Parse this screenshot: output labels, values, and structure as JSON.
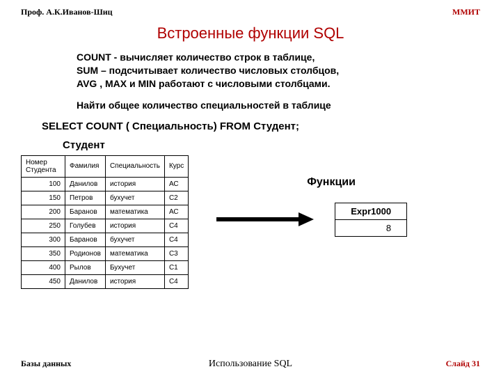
{
  "header": {
    "left": "Проф. А.К.Иванов-Шиц",
    "right": "ММИТ"
  },
  "title": "Встроенные функции SQL",
  "body": {
    "p1_l1": "COUNT - вычисляет количество строк в таблице,",
    "p1_l2": "SUM – подсчитывает количество числовых столбцов,",
    "p1_l3": "AVG , MAX и MIN работают с числовыми столбцами.",
    "p2": "Найти общее количество специальностей в таблице"
  },
  "sql": "SELECT COUNT ( Специальность) FROM Студент;",
  "table_label": "Студент",
  "table": {
    "headers": [
      "Номер Студента",
      "Фамилия",
      "Специальность",
      "Курс"
    ],
    "rows": [
      [
        "100",
        "Данилов",
        "история",
        "АС"
      ],
      [
        "150",
        "Петров",
        "бухучет",
        "С2"
      ],
      [
        "200",
        "Баранов",
        "математика",
        "АС"
      ],
      [
        "250",
        "Голубев",
        "история",
        "С4"
      ],
      [
        "300",
        "Баранов",
        "бухучет",
        "С4"
      ],
      [
        "350",
        "Родионов",
        "математика",
        "С3"
      ],
      [
        "400",
        "Рылов",
        "Бухучет",
        "С1"
      ],
      [
        "450",
        "Данилов",
        "история",
        "С4"
      ]
    ]
  },
  "right": {
    "label": "Функции",
    "result_header": "Expr1000",
    "result_value": "8"
  },
  "footer": {
    "left": "Базы данных",
    "center": "Использование SQL",
    "right": "Слайд 31"
  },
  "chart_data": {
    "type": "table",
    "title": "Студент",
    "columns": [
      "Номер Студента",
      "Фамилия",
      "Специальность",
      "Курс"
    ],
    "rows": [
      [
        100,
        "Данилов",
        "история",
        "АС"
      ],
      [
        150,
        "Петров",
        "бухучет",
        "С2"
      ],
      [
        200,
        "Баранов",
        "математика",
        "АС"
      ],
      [
        250,
        "Голубев",
        "история",
        "С4"
      ],
      [
        300,
        "Баранов",
        "бухучет",
        "С4"
      ],
      [
        350,
        "Родионов",
        "математика",
        "С3"
      ],
      [
        400,
        "Рылов",
        "Бухучет",
        "С1"
      ],
      [
        450,
        "Данилов",
        "история",
        "С4"
      ]
    ],
    "result": {
      "Expr1000": 8
    }
  }
}
